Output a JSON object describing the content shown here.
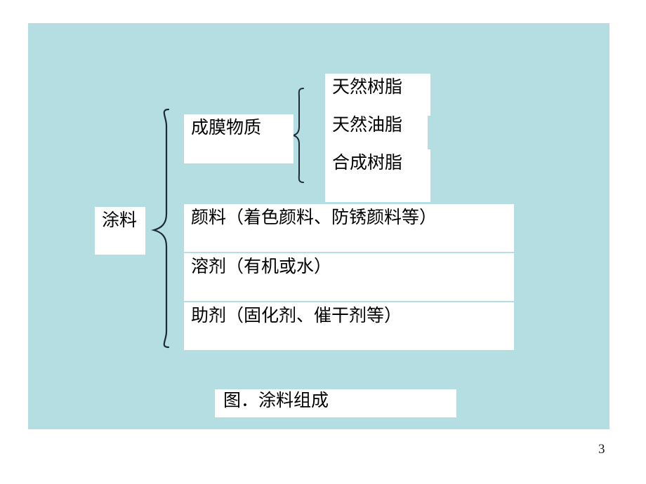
{
  "slide": {
    "page_number": "3",
    "background_color": "#ffffff",
    "canvas_color": "#b4dee2",
    "text_color": "#000000",
    "box_color": "#ffffff"
  },
  "diagram": {
    "root": {
      "label": "涂料"
    },
    "film_former": {
      "label": "成膜物质",
      "children": [
        {
          "label": "天然树脂"
        },
        {
          "label": "天然油脂"
        },
        {
          "label": "合成树脂"
        }
      ]
    },
    "components": [
      {
        "label": "颜料（着色颜料、防锈颜料等）"
      },
      {
        "label": "溶剂（有机或水）"
      },
      {
        "label": "助剂（固化剂、催干剂等）"
      }
    ],
    "caption": "图．涂料组成",
    "braces": [
      {
        "name": "root-brace",
        "orientation": "left-pointing"
      },
      {
        "name": "film-former-brace",
        "orientation": "left-pointing"
      }
    ]
  }
}
